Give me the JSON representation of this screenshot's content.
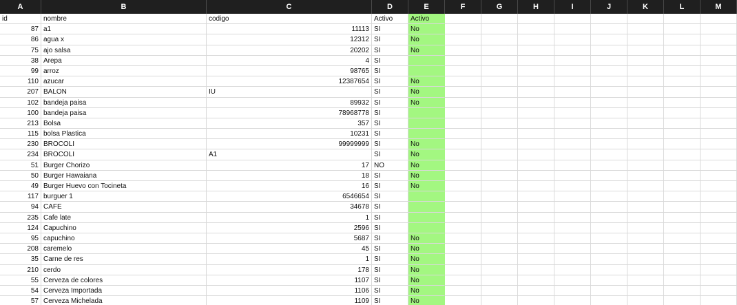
{
  "column_letters": [
    "A",
    "B",
    "C",
    "D",
    "E",
    "F",
    "G",
    "H",
    "I",
    "J",
    "K",
    "L",
    "M"
  ],
  "header_row": {
    "id": "id",
    "nombre": "nombre",
    "codigo": "codigo",
    "activo_d": "Activo",
    "activo_e": "Activo"
  },
  "rows": [
    {
      "id": "87",
      "nombre": "a1",
      "codigo": "11113",
      "activo": "SI",
      "activo2": "No"
    },
    {
      "id": "86",
      "nombre": "agua x",
      "codigo": "12312",
      "activo": "SI",
      "activo2": "No"
    },
    {
      "id": "75",
      "nombre": "ajo salsa",
      "codigo": "20202",
      "activo": "SI",
      "activo2": "No"
    },
    {
      "id": "38",
      "nombre": "Arepa",
      "codigo": "4",
      "activo": "SI",
      "activo2": ""
    },
    {
      "id": "99",
      "nombre": "arroz",
      "codigo": "98765",
      "activo": "SI",
      "activo2": ""
    },
    {
      "id": "110",
      "nombre": "azucar",
      "codigo": "12387654",
      "activo": "SI",
      "activo2": "No"
    },
    {
      "id": "207",
      "nombre": "BALON",
      "codigo": "IU",
      "activo": "SI",
      "activo2": "No"
    },
    {
      "id": "102",
      "nombre": "bandeja paisa",
      "codigo": "89932",
      "activo": "SI",
      "activo2": "No"
    },
    {
      "id": "100",
      "nombre": "bandeja paisa",
      "codigo": "78968778",
      "activo": "SI",
      "activo2": ""
    },
    {
      "id": "213",
      "nombre": "Bolsa",
      "codigo": "357",
      "activo": "SI",
      "activo2": ""
    },
    {
      "id": "115",
      "nombre": "bolsa Plastica",
      "codigo": "10231",
      "activo": "SI",
      "activo2": ""
    },
    {
      "id": "230",
      "nombre": "BROCOLI",
      "codigo": "99999999",
      "activo": "SI",
      "activo2": "No"
    },
    {
      "id": "234",
      "nombre": "BROCOLI",
      "codigo": "A1",
      "activo": "SI",
      "activo2": "No"
    },
    {
      "id": "51",
      "nombre": "Burger Chorizo",
      "codigo": "17",
      "activo": "NO",
      "activo2": "No"
    },
    {
      "id": "50",
      "nombre": "Burger Hawaiana",
      "codigo": "18",
      "activo": "SI",
      "activo2": "No"
    },
    {
      "id": "49",
      "nombre": "Burger Huevo con Tocineta",
      "codigo": "16",
      "activo": "SI",
      "activo2": "No"
    },
    {
      "id": "117",
      "nombre": "burguer 1",
      "codigo": "6546654",
      "activo": "SI",
      "activo2": ""
    },
    {
      "id": "94",
      "nombre": "CAFE",
      "codigo": "34678",
      "activo": "SI",
      "activo2": ""
    },
    {
      "id": "235",
      "nombre": "Cafe late",
      "codigo": "1",
      "activo": "SI",
      "activo2": ""
    },
    {
      "id": "124",
      "nombre": "Capuchino",
      "codigo": "2596",
      "activo": "SI",
      "activo2": ""
    },
    {
      "id": "95",
      "nombre": "capuchino",
      "codigo": "5687",
      "activo": "SI",
      "activo2": "No"
    },
    {
      "id": "208",
      "nombre": "caremelo",
      "codigo": "45",
      "activo": "SI",
      "activo2": "No"
    },
    {
      "id": "35",
      "nombre": "Carne de res",
      "codigo": "1",
      "activo": "SI",
      "activo2": "No"
    },
    {
      "id": "210",
      "nombre": "cerdo",
      "codigo": "178",
      "activo": "SI",
      "activo2": "No"
    },
    {
      "id": "55",
      "nombre": "Cerveza de colores",
      "codigo": "1107",
      "activo": "SI",
      "activo2": "No"
    },
    {
      "id": "54",
      "nombre": "Cerveza Importada",
      "codigo": "1106",
      "activo": "SI",
      "activo2": "No"
    },
    {
      "id": "57",
      "nombre": "Cerveza Michelada",
      "codigo": "1109",
      "activo": "SI",
      "activo2": "No"
    }
  ],
  "colors": {
    "header_bg": "#1f1f1f",
    "highlight_column": "#a3f781",
    "gridline": "#d9d9d9"
  }
}
